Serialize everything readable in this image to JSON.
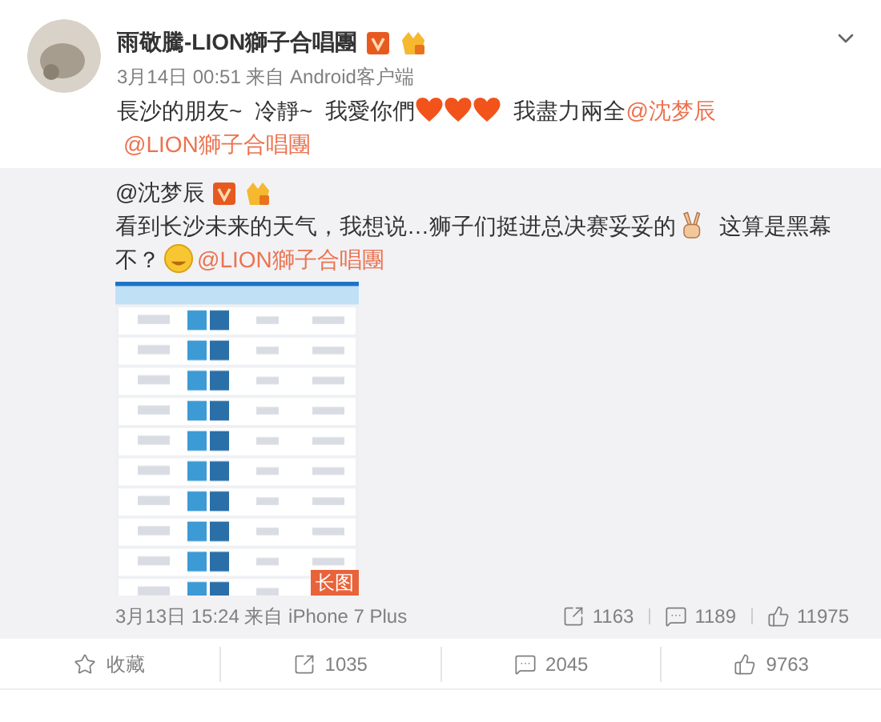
{
  "post": {
    "author": "雨敬騰-LION獅子合唱團",
    "meta": "3月14日 00:51 来自 Android客户端",
    "content": [
      {
        "kind": "text",
        "text": "長沙的朋友~  冷靜~  我愛你們"
      },
      {
        "kind": "heart"
      },
      {
        "kind": "heart"
      },
      {
        "kind": "heart"
      },
      {
        "kind": "text",
        "text": "  我盡力兩全"
      },
      {
        "kind": "mention",
        "text": "@沈梦辰"
      },
      {
        "kind": "mention",
        "text": "@LION獅子合唱團"
      }
    ]
  },
  "repost": {
    "author": "@沈梦辰",
    "content": [
      {
        "kind": "text",
        "text": "看到长沙未来的天气，我想说…狮子们挺进总决赛妥妥的"
      },
      {
        "kind": "victory"
      },
      {
        "kind": "text",
        "text": "  这算是黑幕不？"
      },
      {
        "kind": "grin"
      },
      {
        "kind": "mention",
        "text": "@LION獅子合唱團"
      }
    ],
    "image": {
      "kind": "picture",
      "badge": "长图"
    },
    "meta": "3月13日 15:24 来自 iPhone 7 Plus",
    "stats": [
      {
        "kind": "share",
        "count": "1163"
      },
      {
        "kind": "comment",
        "count": "1189"
      },
      {
        "kind": "like",
        "count": "11975"
      }
    ]
  },
  "actions": [
    {
      "kind": "favorite",
      "label": "收藏"
    },
    {
      "kind": "share",
      "label": "1035"
    },
    {
      "kind": "comment",
      "label": "2045"
    },
    {
      "kind": "like",
      "label": "9763"
    }
  ]
}
